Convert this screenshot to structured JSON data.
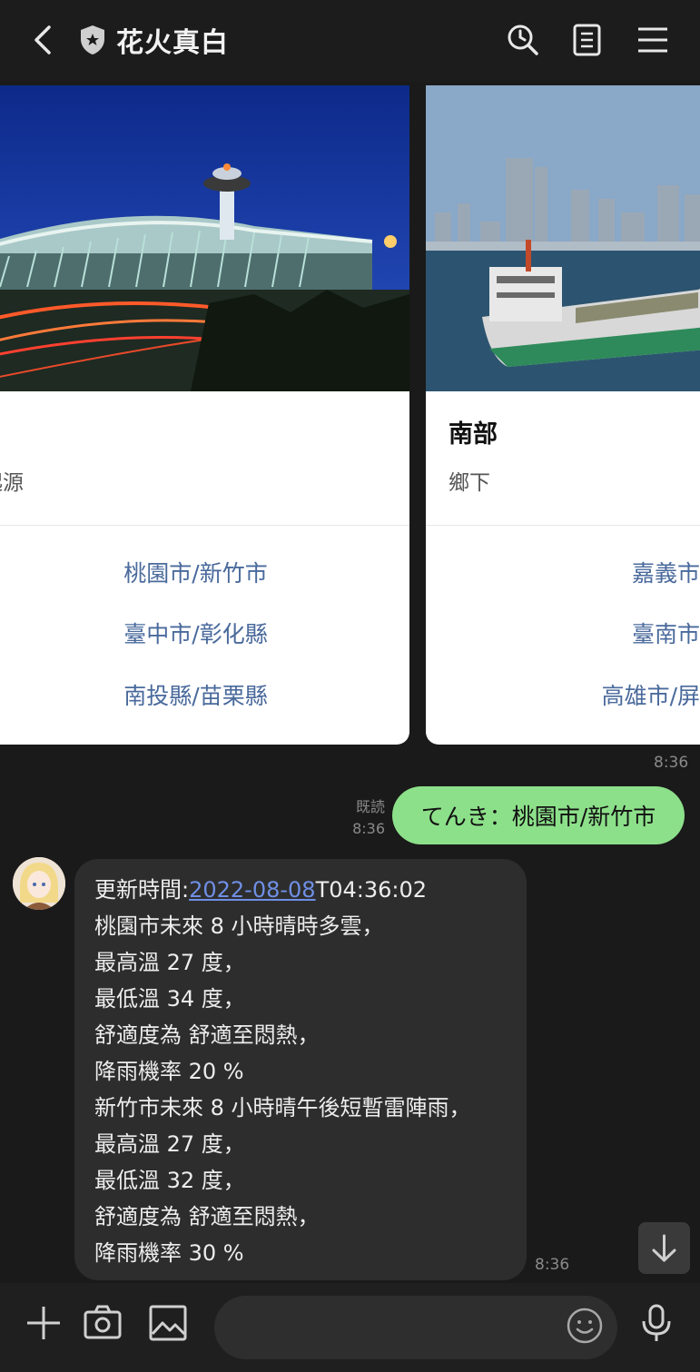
{
  "header": {
    "title": "花火真白",
    "icons": [
      "back-icon",
      "shield-icon",
      "search-history-icon",
      "notes-icon",
      "menu-icon"
    ]
  },
  "carousel": {
    "cards": [
      {
        "subtitle_fragment": "起源",
        "actions": [
          "桃園市/新竹市",
          "臺中市/彰化縣",
          "南投縣/苗栗縣"
        ]
      },
      {
        "title": "南部",
        "subtitle": "鄉下",
        "actions": [
          "嘉義市",
          "臺南市",
          "高雄市/屏"
        ]
      }
    ],
    "timestamp": "8:36"
  },
  "outgoing": {
    "read_label": "既読",
    "time": "8:36",
    "text": "てんき：桃園市/新竹市"
  },
  "incoming": {
    "time": "8:36",
    "update_prefix": "更新時間:",
    "update_date": "2022-08-08",
    "update_suffix": "T04:36:02",
    "lines": [
      "桃園市未來 8 小時晴時多雲，",
      "最高溫 27 度，",
      "最低溫 34 度，",
      "舒適度為 舒適至悶熱，",
      "降雨機率 20 %",
      "新竹市未來 8 小時晴午後短暫雷陣雨，",
      "最高溫 27 度，",
      "最低溫 32 度，",
      "舒適度為 舒適至悶熱，",
      "降雨機率 30 %"
    ]
  },
  "composer": {
    "placeholder": "",
    "icons": [
      "plus-icon",
      "camera-icon",
      "image-icon",
      "emoji-icon",
      "microphone-icon"
    ]
  },
  "colors": {
    "background": "#1a1a1a",
    "outgoing_bubble": "#8de08a",
    "incoming_bubble": "#2d2d2d",
    "action_link": "#4a6a9c",
    "date_link": "#6f8fe6"
  }
}
